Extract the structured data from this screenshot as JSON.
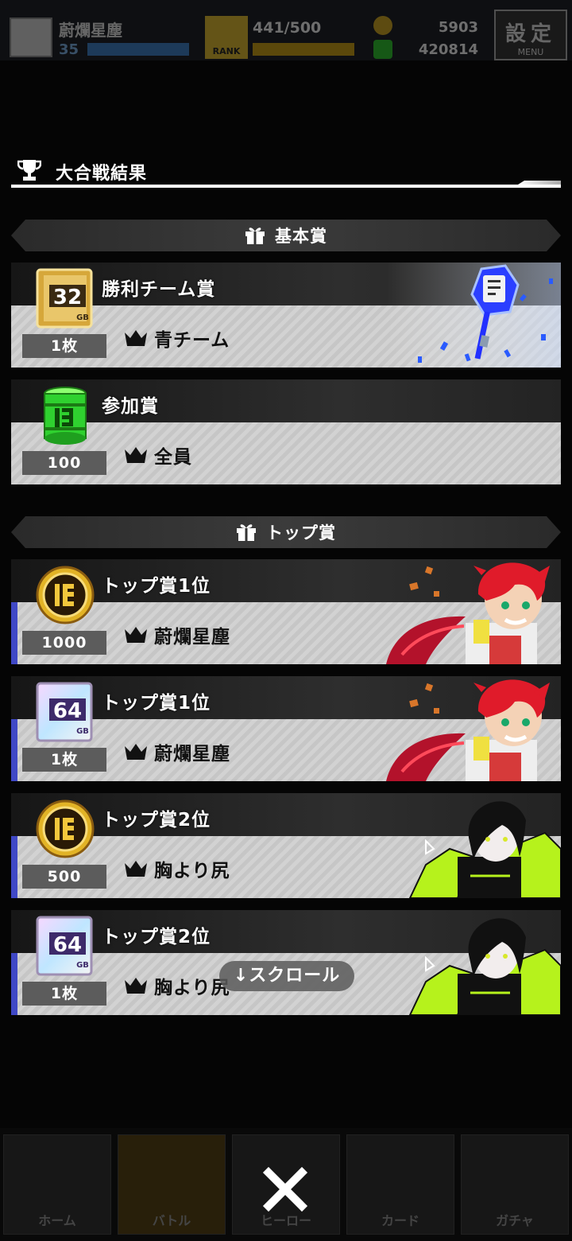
{
  "hud": {
    "player_name": "蔚爛星塵",
    "player_level": "35",
    "rank_label": "RANK",
    "stamina": "441/500",
    "currency_gold": "5903",
    "currency_gb": "420814",
    "menu_kanji": "設定",
    "menu_label": "MENU"
  },
  "results": {
    "title": "大合戦結果",
    "sections": [
      {
        "label": "基本賞",
        "awards": [
          {
            "name": "勝利チーム賞",
            "winner": "青チーム",
            "quantity": "1枚",
            "icon": "chip-32gb-icon",
            "chip": "32",
            "art": "key-art"
          },
          {
            "name": "参加賞",
            "winner": "全員",
            "quantity": "100",
            "icon": "green-barrel-icon"
          }
        ]
      },
      {
        "label": "トップ賞",
        "awards": [
          {
            "name": "トップ賞1位",
            "winner": "蔚爛星塵",
            "quantity": "1000",
            "icon": "gold-coin-icon",
            "art": "red-hair-character"
          },
          {
            "name": "トップ賞1位",
            "winner": "蔚爛星塵",
            "quantity": "1枚",
            "icon": "chip-64gb-icon",
            "chip": "64",
            "art": "red-hair-character"
          },
          {
            "name": "トップ賞2位",
            "winner": "胸より尻",
            "quantity": "500",
            "icon": "gold-coin-icon",
            "art": "black-hair-character"
          },
          {
            "name": "トップ賞2位",
            "winner": "胸より尻",
            "quantity": "1枚",
            "icon": "chip-64gb-icon",
            "chip": "64",
            "art": "black-hair-character"
          }
        ]
      }
    ]
  },
  "chip_unit": "GB",
  "scroll_hint": "↓スクロール",
  "close_icon": "close-icon",
  "bottom_nav": [
    "ホーム",
    "バトル",
    "ヒーロー",
    "カード",
    "ガチャ"
  ],
  "colors": {
    "accent_blue": "#3f48c6",
    "chip_gold": "#d6a73a",
    "coin_gold": "#e2b326",
    "barrel_green": "#2fd12f"
  }
}
